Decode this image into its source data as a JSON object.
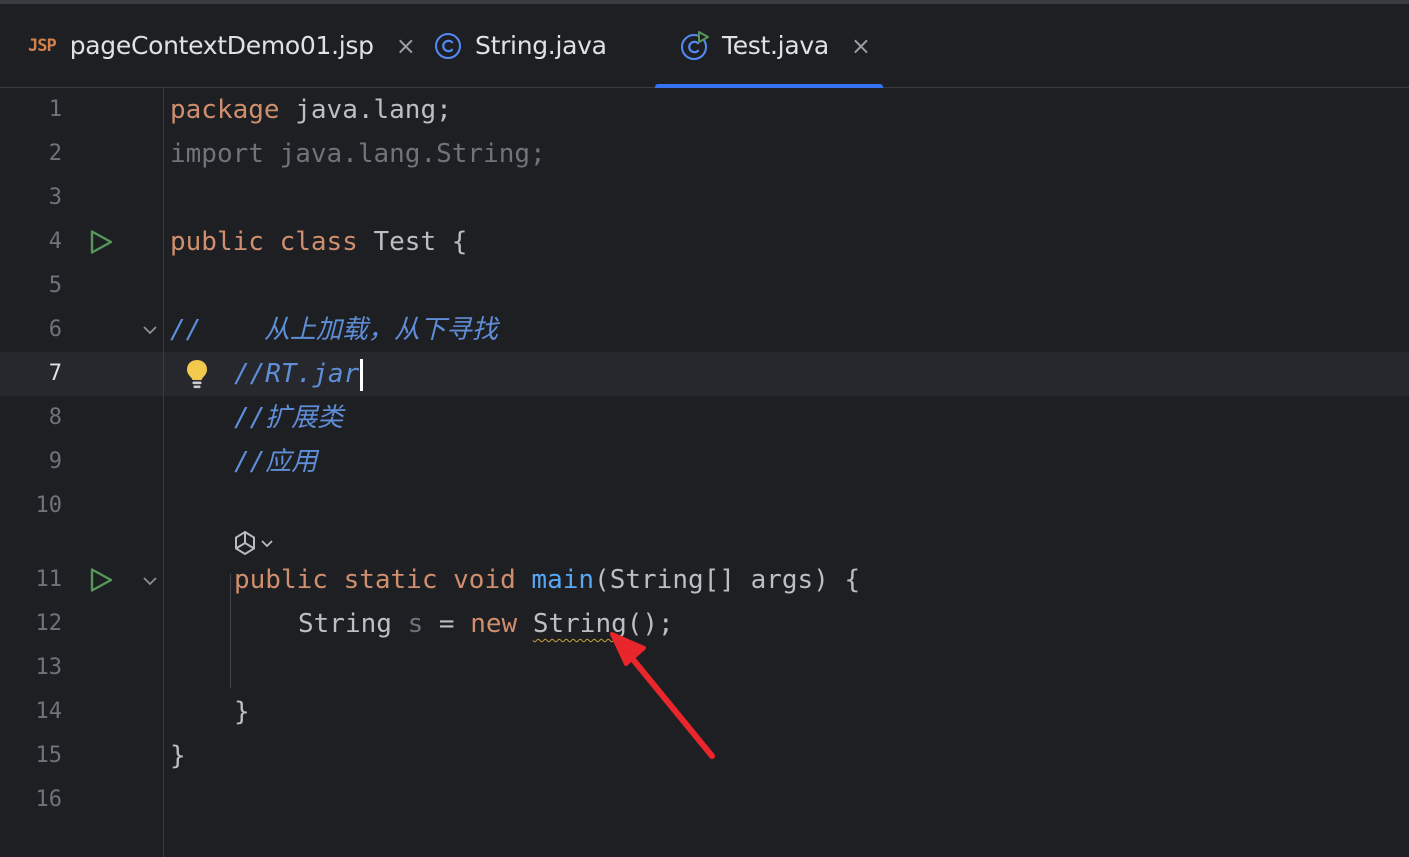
{
  "tabs": [
    {
      "icon": "jsp-file-icon",
      "icon_text": "JSP",
      "label": "pageContextDemo01.jsp",
      "close": "×"
    },
    {
      "icon": "java-class-icon",
      "label": "String.java"
    },
    {
      "icon": "java-class-run-icon",
      "label": "Test.java",
      "close": "×",
      "active": true
    }
  ],
  "colors": {
    "accent": "#3574f0",
    "keyword": "#cf8e6d",
    "comment": "#5f8ed8",
    "method": "#56a8f5",
    "warning": "#c9a23b",
    "run": "#57965c",
    "annotation_arrow": "#e8262c"
  },
  "editor": {
    "current_line": 7,
    "lines": [
      {
        "n": "1"
      },
      {
        "n": "2"
      },
      {
        "n": "3"
      },
      {
        "n": "4"
      },
      {
        "n": "5"
      },
      {
        "n": "6"
      },
      {
        "n": "7"
      },
      {
        "n": "8"
      },
      {
        "n": "9"
      },
      {
        "n": "10"
      },
      {
        "n": "11"
      },
      {
        "n": "12"
      },
      {
        "n": "13"
      },
      {
        "n": "14"
      },
      {
        "n": "15"
      },
      {
        "n": "16"
      }
    ],
    "code": {
      "l1": {
        "kw": "package",
        "rest": " java.lang;"
      },
      "l2": {
        "text": "import java.lang.String;"
      },
      "l4": {
        "kw": "public class",
        "rest": " Test {"
      },
      "l6": {
        "text": "//    从上加载，从下寻找"
      },
      "l7": {
        "text": "//RT.jar"
      },
      "l8": {
        "text": "//扩展类"
      },
      "l9": {
        "text": "//应用"
      },
      "l11": {
        "kw": "public static void",
        "name": "main",
        "rest": "(String[] args) {"
      },
      "l12": {
        "type": "String",
        "var": "s",
        "eq": " = ",
        "kw": "new",
        "ctor": "String",
        "rest": "();"
      },
      "l14": {
        "text": "}"
      },
      "l15": {
        "text": "}"
      }
    },
    "gutter_icons": [
      "run-gutter-icon",
      "fold-icon",
      "intention-bulb-icon",
      "ai-hint-icon"
    ]
  }
}
